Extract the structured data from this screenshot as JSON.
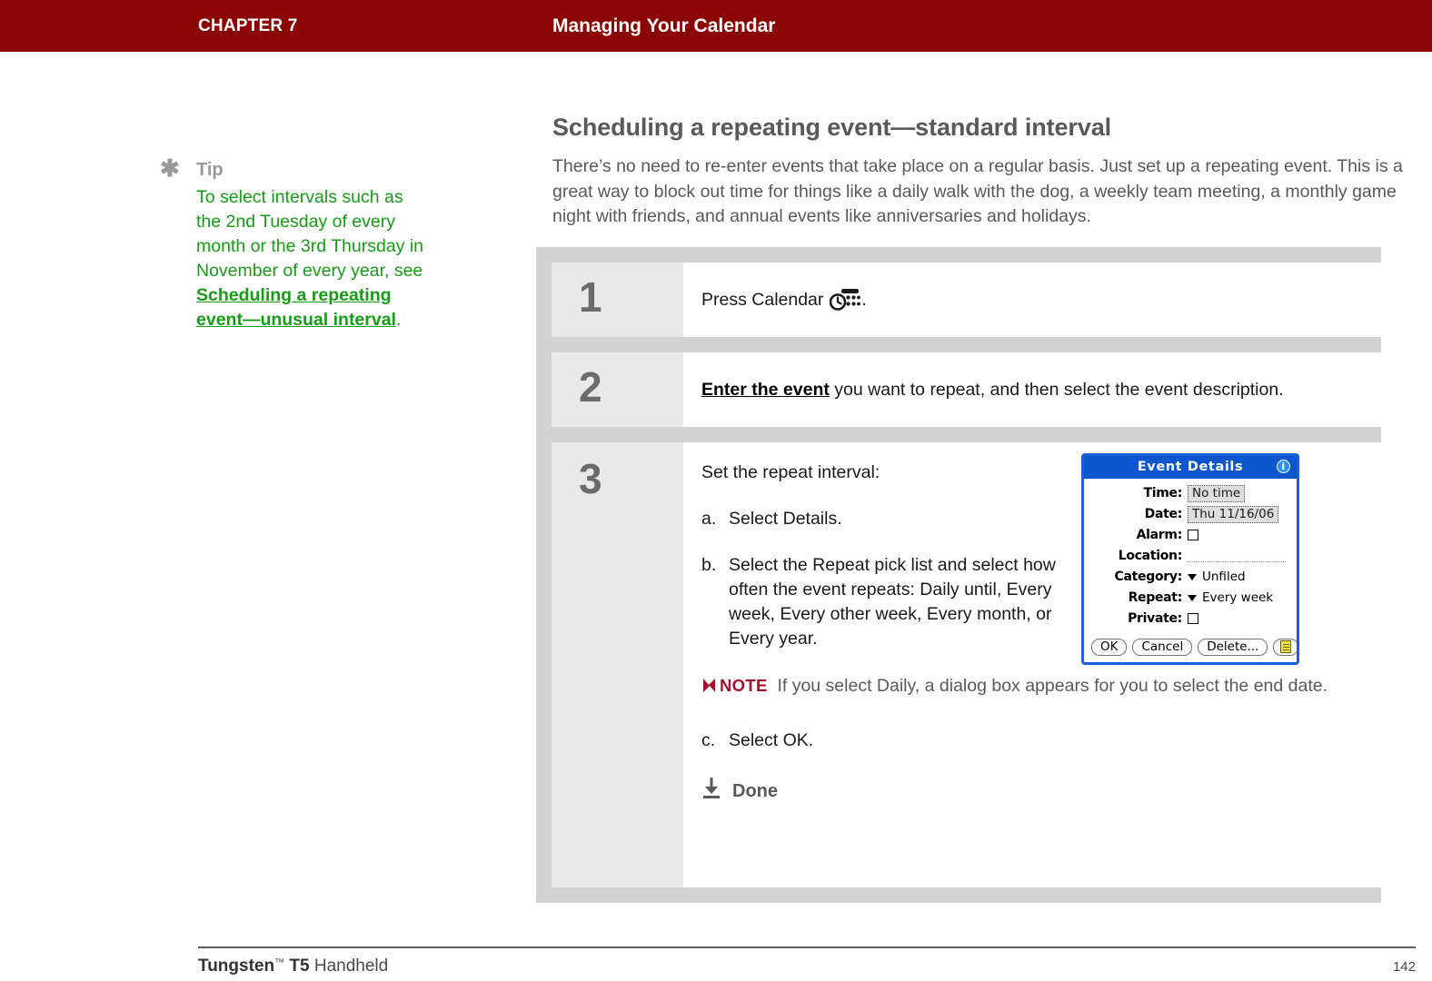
{
  "header": {
    "chapter": "CHAPTER 7",
    "section": "Managing Your Calendar",
    "background_color": "#8b0505",
    "text_color": "#ffffff"
  },
  "tip": {
    "icon": "asterisk-icon",
    "label": "Tip",
    "text_before": "To select intervals such as the 2nd Tuesday of every month or the 3rd Thursday in November of every year, see ",
    "link_text": "Scheduling a repeating event—unusual interval",
    "text_after": ".",
    "color": "#179c17",
    "label_color": "#9a9a9a"
  },
  "main": {
    "heading": "Scheduling a repeating event—standard interval",
    "intro": "There’s no need to re-enter events that take place on a regular basis. Just set up a repeating event. This is a great way to block out time for things like a daily walk with the dog, a weekly team meeting, a monthly game night with friends, and annual events like anniversaries and holidays."
  },
  "steps": [
    {
      "number": "1",
      "text_before": "Press Calendar",
      "icon": "calendar-button-icon",
      "text_after": "."
    },
    {
      "number": "2",
      "link_text": "Enter the event",
      "text_after": " you want to repeat, and then select the event description."
    },
    {
      "number": "3",
      "lead": "Set the repeat interval:",
      "items": [
        {
          "mark": "a.",
          "text": "Select Details."
        },
        {
          "mark": "b.",
          "text": "Select the Repeat pick list and select how often the event repeats: Daily until, Every week, Every other week, Every month, or Every year."
        }
      ],
      "note": {
        "icon": "note-flag-icon",
        "badge": "NOTE",
        "text": "If you select Daily, a dialog box appears for you to select the end date.",
        "badge_color": "#a3102a"
      },
      "item_c": {
        "mark": "c.",
        "text": "Select OK."
      },
      "done": {
        "icon": "download-arrow-icon",
        "label": "Done"
      }
    }
  ],
  "dialog": {
    "title": "Event Details",
    "info_icon": "info-icon",
    "title_bg": "#0b56cf",
    "border_color": "#1a5fd8",
    "fields": [
      {
        "label": "Time:",
        "value": "No time",
        "kind": "boxed"
      },
      {
        "label": "Date:",
        "value": "Thu 11/16/06",
        "kind": "boxed"
      },
      {
        "label": "Alarm:",
        "value": "",
        "kind": "checkbox"
      },
      {
        "label": "Location:",
        "value": "",
        "kind": "dotline"
      },
      {
        "label": "Category:",
        "value": "Unfiled",
        "kind": "picklist"
      },
      {
        "label": "Repeat:",
        "value": "Every week",
        "kind": "picklist"
      },
      {
        "label": "Private:",
        "value": "",
        "kind": "checkbox"
      }
    ],
    "buttons": [
      {
        "label": "OK",
        "name": "ok-button"
      },
      {
        "label": "Cancel",
        "name": "cancel-button"
      },
      {
        "label": "Delete...",
        "name": "delete-button"
      }
    ],
    "note_button_icon": "note-page-icon"
  },
  "footer": {
    "product": "Tungsten",
    "trademark": "™",
    "model": "T5",
    "kind": "Handheld",
    "page": "142"
  }
}
